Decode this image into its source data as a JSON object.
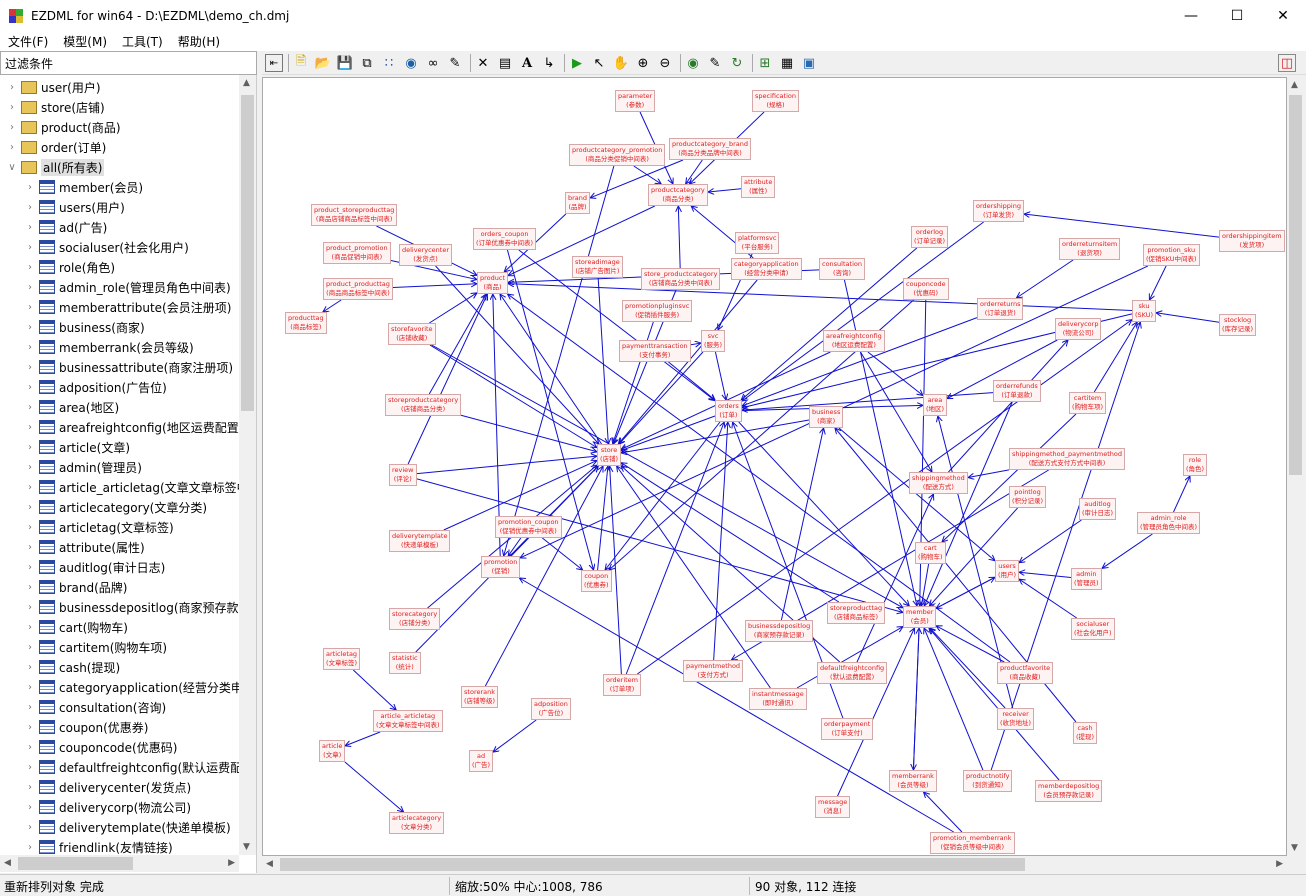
{
  "window": {
    "title": "EZDML for win64 - D:\\EZDML\\demo_ch.dmj"
  },
  "menu": [
    "文件(F)",
    "模型(M)",
    "工具(T)",
    "帮助(H)"
  ],
  "filter": {
    "label": "过滤条件"
  },
  "tree": {
    "groups": [
      "user(用户)",
      "store(店铺)",
      "product(商品)",
      "order(订单)",
      "all(所有表)"
    ],
    "tables": [
      "member(会员)",
      "users(用户)",
      "ad(广告)",
      "socialuser(社会化用户)",
      "role(角色)",
      "admin_role(管理员角色中间表)",
      "memberattribute(会员注册项)",
      "business(商家)",
      "memberrank(会员等级)",
      "businessattribute(商家注册项)",
      "adposition(广告位)",
      "area(地区)",
      "areafreightconfig(地区运费配置",
      "article(文章)",
      "admin(管理员)",
      "article_articletag(文章文章标签中",
      "articlecategory(文章分类)",
      "articletag(文章标签)",
      "attribute(属性)",
      "auditlog(审计日志)",
      "brand(品牌)",
      "businessdepositlog(商家预存款",
      "cart(购物车)",
      "cartitem(购物车项)",
      "cash(提现)",
      "categoryapplication(经营分类申",
      "consultation(咨询)",
      "coupon(优惠券)",
      "couponcode(优惠码)",
      "defaultfreightconfig(默认运费配",
      "deliverycenter(发货点)",
      "deliverycorp(物流公司)",
      "deliverytemplate(快递单模板)",
      "friendlink(友情链接)"
    ]
  },
  "status": {
    "message": "重新排列对象 完成",
    "zoom": "缩放:50% 中心:1008, 786",
    "counts": "90 对象, 112 连接"
  },
  "entities": [
    {
      "id": "parameter",
      "name": "parameter",
      "cn": "(参数)"
    },
    {
      "id": "specification",
      "name": "specification",
      "cn": "(规格)"
    },
    {
      "id": "productcategory_promotion",
      "name": "productcategory_promotion",
      "cn": "(商品分类促销中间表)"
    },
    {
      "id": "productcategory_brand",
      "name": "productcategory_brand",
      "cn": "(商品分类品牌中间表)"
    },
    {
      "id": "productcategory",
      "name": "productcategory",
      "cn": "(商品分类)"
    },
    {
      "id": "attribute",
      "name": "attribute",
      "cn": "(属性)"
    },
    {
      "id": "brand",
      "name": "brand",
      "cn": "(品牌)"
    },
    {
      "id": "product_storeproducttag",
      "name": "product_storeproducttag",
      "cn": "(商品店铺商品标签中间表)"
    },
    {
      "id": "orders_coupon",
      "name": "orders_coupon",
      "cn": "(订单优惠券中间表)"
    },
    {
      "id": "orderlog",
      "name": "orderlog",
      "cn": "(订单记录)"
    },
    {
      "id": "ordershipping",
      "name": "ordershipping",
      "cn": "(订单发货)"
    },
    {
      "id": "ordershippingitem",
      "name": "ordershippingitem",
      "cn": "(发货项)"
    },
    {
      "id": "platformsvc",
      "name": "platformsvc",
      "cn": "(平台服务)"
    },
    {
      "id": "product_promotion",
      "name": "product_promotion",
      "cn": "(商品促销中间表)"
    },
    {
      "id": "deliverycenter",
      "name": "deliverycenter",
      "cn": "(发货点)"
    },
    {
      "id": "storeadimage",
      "name": "storeadimage",
      "cn": "(店铺广告图片)"
    },
    {
      "id": "categoryapplication",
      "name": "categoryapplication",
      "cn": "(经营分类申请)"
    },
    {
      "id": "consultation",
      "name": "consultation",
      "cn": "(咨询)"
    },
    {
      "id": "orderreturnsitem",
      "name": "orderreturnsitem",
      "cn": "(退货项)"
    },
    {
      "id": "promotion_sku",
      "name": "promotion_sku",
      "cn": "(促销SKU中间表)"
    },
    {
      "id": "product",
      "name": "product",
      "cn": "(商品)"
    },
    {
      "id": "store_productcategory",
      "name": "store_productcategory",
      "cn": "(店铺商品分类中间表)"
    },
    {
      "id": "product_producttag",
      "name": "product_producttag",
      "cn": "(商品商品标签中间表)"
    },
    {
      "id": "couponcode",
      "name": "couponcode",
      "cn": "(优惠码)"
    },
    {
      "id": "producttag",
      "name": "producttag",
      "cn": "(商品标签)"
    },
    {
      "id": "promotionpluginsvc",
      "name": "promotionpluginsvc",
      "cn": "(促销插件服务)"
    },
    {
      "id": "orderreturns",
      "name": "orderreturns",
      "cn": "(订单退货)"
    },
    {
      "id": "sku",
      "name": "sku",
      "cn": "(SKU)"
    },
    {
      "id": "stocklog",
      "name": "stocklog",
      "cn": "(库存记录)"
    },
    {
      "id": "storefavorite",
      "name": "storefavorite",
      "cn": "(店铺收藏)"
    },
    {
      "id": "svc",
      "name": "svc",
      "cn": "(服务)"
    },
    {
      "id": "areafreightconfig",
      "name": "areafreightconfig",
      "cn": "(地区运费配置)"
    },
    {
      "id": "deliverycorp",
      "name": "deliverycorp",
      "cn": "(物流公司)"
    },
    {
      "id": "paymenttransaction",
      "name": "paymenttransaction",
      "cn": "(支付事务)"
    },
    {
      "id": "orderrefunds",
      "name": "orderrefunds",
      "cn": "(订单退款)"
    },
    {
      "id": "storeproductcategory",
      "name": "storeproductcategory",
      "cn": "(店铺商品分类)"
    },
    {
      "id": "orders",
      "name": "orders",
      "cn": "(订单)"
    },
    {
      "id": "business",
      "name": "business",
      "cn": "(商家)"
    },
    {
      "id": "area",
      "name": "area",
      "cn": "(地区)"
    },
    {
      "id": "cartitem",
      "name": "cartitem",
      "cn": "(购物车项)"
    },
    {
      "id": "store",
      "name": "store",
      "cn": "(店铺)"
    },
    {
      "id": "shippingmethod_paymentmethod",
      "name": "shippingmethod_paymentmethod",
      "cn": "(配送方式支付方式中间表)"
    },
    {
      "id": "review",
      "name": "review",
      "cn": "(评论)"
    },
    {
      "id": "shippingmethod",
      "name": "shippingmethod",
      "cn": "(配送方式)"
    },
    {
      "id": "role",
      "name": "role",
      "cn": "(角色)"
    },
    {
      "id": "pointlog",
      "name": "pointlog",
      "cn": "(积分记录)"
    },
    {
      "id": "auditlog",
      "name": "auditlog",
      "cn": "(审计日志)"
    },
    {
      "id": "admin_role",
      "name": "admin_role",
      "cn": "(管理员角色中间表)"
    },
    {
      "id": "promotion_coupon",
      "name": "promotion_coupon",
      "cn": "(促销优惠券中间表)"
    },
    {
      "id": "deliverytemplate",
      "name": "deliverytemplate",
      "cn": "(快递单模板)"
    },
    {
      "id": "cart",
      "name": "cart",
      "cn": "(购物车)"
    },
    {
      "id": "promotion",
      "name": "promotion",
      "cn": "(促销)"
    },
    {
      "id": "users",
      "name": "users",
      "cn": "(用户)"
    },
    {
      "id": "admin",
      "name": "admin",
      "cn": "(管理员)"
    },
    {
      "id": "coupon",
      "name": "coupon",
      "cn": "(优惠券)"
    },
    {
      "id": "storecategory",
      "name": "storecategory",
      "cn": "(店铺分类)"
    },
    {
      "id": "storeproducttag",
      "name": "storeproducttag",
      "cn": "(店铺商品标签)"
    },
    {
      "id": "businessdepositlog",
      "name": "businessdepositlog",
      "cn": "(商家预存款记录)"
    },
    {
      "id": "member",
      "name": "member",
      "cn": "(会员)"
    },
    {
      "id": "socialuser",
      "name": "socialuser",
      "cn": "(社会化用户)"
    },
    {
      "id": "articletag",
      "name": "articletag",
      "cn": "(文章标签)"
    },
    {
      "id": "statistic",
      "name": "statistic",
      "cn": "(统计)"
    },
    {
      "id": "paymentmethod",
      "name": "paymentmethod",
      "cn": "(支付方式)"
    },
    {
      "id": "defaultfreightconfig",
      "name": "defaultfreightconfig",
      "cn": "(默认运费配置)"
    },
    {
      "id": "productfavorite",
      "name": "productfavorite",
      "cn": "(商品收藏)"
    },
    {
      "id": "orderitem",
      "name": "orderitem",
      "cn": "(订单项)"
    },
    {
      "id": "instantmessage",
      "name": "instantmessage",
      "cn": "(即时通讯)"
    },
    {
      "id": "storerank",
      "name": "storerank",
      "cn": "(店铺等级)"
    },
    {
      "id": "adposition",
      "name": "adposition",
      "cn": "(广告位)"
    },
    {
      "id": "article_articletag",
      "name": "article_articletag",
      "cn": "(文章文章标签中间表)"
    },
    {
      "id": "receiver",
      "name": "receiver",
      "cn": "(收货地址)"
    },
    {
      "id": "cash",
      "name": "cash",
      "cn": "(提现)"
    },
    {
      "id": "orderpayment",
      "name": "orderpayment",
      "cn": "(订单支付)"
    },
    {
      "id": "article",
      "name": "article",
      "cn": "(文章)"
    },
    {
      "id": "ad",
      "name": "ad",
      "cn": "(广告)"
    },
    {
      "id": "memberrank",
      "name": "memberrank",
      "cn": "(会员等级)"
    },
    {
      "id": "productnotify",
      "name": "productnotify",
      "cn": "(到货通知)"
    },
    {
      "id": "memberdepositlog",
      "name": "memberdepositlog",
      "cn": "(会员预存款记录)"
    },
    {
      "id": "message",
      "name": "message",
      "cn": "(消息)"
    },
    {
      "id": "articlecategory",
      "name": "articlecategory",
      "cn": "(文章分类)"
    },
    {
      "id": "promotion_memberrank",
      "name": "promotion_memberrank",
      "cn": "(促销会员等级中间表)"
    }
  ],
  "links": [
    [
      "parameter",
      "productcategory"
    ],
    [
      "specification",
      "productcategory"
    ],
    [
      "productcategory_promotion",
      "productcategory"
    ],
    [
      "productcategory_brand",
      "productcategory"
    ],
    [
      "attribute",
      "productcategory"
    ],
    [
      "productcategory_brand",
      "brand"
    ],
    [
      "productcategory_promotion",
      "promotion"
    ],
    [
      "brand",
      "product"
    ],
    [
      "productcategory",
      "product"
    ],
    [
      "product_storeproducttag",
      "product"
    ],
    [
      "orders_coupon",
      "orders"
    ],
    [
      "orders_coupon",
      "coupon"
    ],
    [
      "product_promotion",
      "product"
    ],
    [
      "deliverycenter",
      "store"
    ],
    [
      "storeadimage",
      "store"
    ],
    [
      "categoryapplication",
      "store"
    ],
    [
      "categoryapplication",
      "productcategory"
    ],
    [
      "consultation",
      "product"
    ],
    [
      "consultation",
      "member"
    ],
    [
      "store_productcategory",
      "store"
    ],
    [
      "store_productcategory",
      "productcategory"
    ],
    [
      "product_producttag",
      "product"
    ],
    [
      "product_producttag",
      "producttag"
    ],
    [
      "couponcode",
      "coupon"
    ],
    [
      "couponcode",
      "member"
    ],
    [
      "promotionpluginsvc",
      "store"
    ],
    [
      "orderreturns",
      "orders"
    ],
    [
      "orderreturnsitem",
      "orderreturns"
    ],
    [
      "promotion_sku",
      "sku"
    ],
    [
      "promotion_sku",
      "promotion"
    ],
    [
      "sku",
      "product"
    ],
    [
      "stocklog",
      "sku"
    ],
    [
      "storefavorite",
      "store"
    ],
    [
      "storefavorite",
      "member"
    ],
    [
      "svc",
      "store"
    ],
    [
      "platformsvc",
      "svc"
    ],
    [
      "paymenttransaction",
      "svc"
    ],
    [
      "paymenttransaction",
      "orders"
    ],
    [
      "areafreightconfig",
      "area"
    ],
    [
      "areafreightconfig",
      "shippingmethod"
    ],
    [
      "areafreightconfig",
      "store"
    ],
    [
      "orderrefunds",
      "orders"
    ],
    [
      "storeproductcategory",
      "store"
    ],
    [
      "storeproductcategory",
      "product"
    ],
    [
      "orders",
      "store"
    ],
    [
      "orders",
      "member"
    ],
    [
      "orders",
      "area"
    ],
    [
      "business",
      "store"
    ],
    [
      "business",
      "users"
    ],
    [
      "cartitem",
      "sku"
    ],
    [
      "cartitem",
      "cart"
    ],
    [
      "review",
      "product"
    ],
    [
      "review",
      "member"
    ],
    [
      "review",
      "store"
    ],
    [
      "shippingmethod",
      "deliverycorp"
    ],
    [
      "shippingmethod_paymentmethod",
      "shippingmethod"
    ],
    [
      "shippingmethod_paymentmethod",
      "paymentmethod"
    ],
    [
      "pointlog",
      "member"
    ],
    [
      "auditlog",
      "users"
    ],
    [
      "admin_role",
      "role"
    ],
    [
      "admin_role",
      "admin"
    ],
    [
      "admin",
      "users"
    ],
    [
      "promotion_coupon",
      "promotion"
    ],
    [
      "promotion_coupon",
      "coupon"
    ],
    [
      "deliverytemplate",
      "store"
    ],
    [
      "cart",
      "member"
    ],
    [
      "promotion",
      "store"
    ],
    [
      "users",
      "member"
    ],
    [
      "coupon",
      "store"
    ],
    [
      "storecategory",
      "store"
    ],
    [
      "storeproducttag",
      "store"
    ],
    [
      "businessdepositlog",
      "business"
    ],
    [
      "member",
      "users"
    ],
    [
      "member",
      "memberrank"
    ],
    [
      "socialuser",
      "users"
    ],
    [
      "articletag",
      "article_articletag"
    ],
    [
      "statistic",
      "store"
    ],
    [
      "paymentmethod",
      "orders"
    ],
    [
      "defaultfreightconfig",
      "store"
    ],
    [
      "defaultfreightconfig",
      "shippingmethod"
    ],
    [
      "productfavorite",
      "product"
    ],
    [
      "productfavorite",
      "member"
    ],
    [
      "orderitem",
      "orders"
    ],
    [
      "orderitem",
      "sku"
    ],
    [
      "instantmessage",
      "store"
    ],
    [
      "storerank",
      "store"
    ],
    [
      "adposition",
      "ad"
    ],
    [
      "article_articletag",
      "article"
    ],
    [
      "receiver",
      "member"
    ],
    [
      "receiver",
      "area"
    ],
    [
      "cash",
      "business"
    ],
    [
      "orderpayment",
      "orders"
    ],
    [
      "article",
      "articlecategory"
    ],
    [
      "memberrank",
      "member"
    ],
    [
      "productnotify",
      "member"
    ],
    [
      "productnotify",
      "sku"
    ],
    [
      "memberdepositlog",
      "member"
    ],
    [
      "message",
      "member"
    ],
    [
      "promotion_memberrank",
      "memberrank"
    ],
    [
      "promotion_memberrank",
      "promotion"
    ],
    [
      "orderlog",
      "orders"
    ],
    [
      "ordershipping",
      "orders"
    ],
    [
      "ordershippingitem",
      "ordershipping"
    ],
    [
      "orderitem",
      "store"
    ],
    [
      "instantmessage",
      "member"
    ],
    [
      "orders",
      "coupon"
    ],
    [
      "promotion",
      "product"
    ],
    [
      "sku",
      "orders"
    ],
    [
      "deliverycorp",
      "area"
    ],
    [
      "orderrefunds",
      "member"
    ],
    [
      "svc",
      "orders"
    ],
    [
      "storefavorite",
      "product"
    ],
    [
      "store",
      "product"
    ]
  ]
}
